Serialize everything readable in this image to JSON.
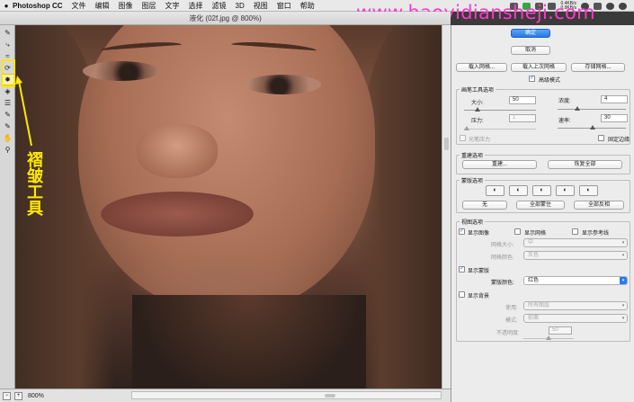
{
  "menubar": {
    "apple": "",
    "app": "Photoshop CC",
    "menus": [
      "文件",
      "编辑",
      "图像",
      "图层",
      "文字",
      "选择",
      "滤镜",
      "3D",
      "视图",
      "窗口",
      "帮助"
    ],
    "net_up": "0.4KB/s",
    "net_down": "0.9KB/s"
  },
  "watermark": "www.haoyidiansheji.com",
  "window": {
    "title": "液化 (02f.jpg @ 800%)"
  },
  "annotation": {
    "label": "褶皱工具"
  },
  "status": {
    "zoom": "800%"
  },
  "panel": {
    "ok": "确定",
    "cancel": "取消",
    "load_mesh": "载入网格...",
    "load_last": "载入上次网格",
    "save_mesh": "存储网格...",
    "advanced": "高级模式",
    "brush_group": "画笔工具选项",
    "size_label": "大小:",
    "size_value": "50",
    "density_label": "浓度:",
    "density_value": "4",
    "pressure_label": "压力:",
    "pressure_value": "1",
    "rate_label": "速率:",
    "rate_value": "30",
    "stylus": "光笔压力",
    "pin_edges": "固定边缘",
    "rebuild_group": "重建选项",
    "rebuild_btn": "重建...",
    "restore_btn": "恢复全部",
    "mask_group": "蒙版选项",
    "mask_none": "无",
    "mask_all": "全部蒙住",
    "mask_invert": "全部反相",
    "view_group": "视图选项",
    "show_image": "显示图像",
    "show_mesh": "显示网格",
    "show_guides": "显示参考线",
    "mesh_size_label": "网格大小:",
    "mesh_size_value": "中",
    "mesh_color_label": "网格颜色:",
    "mesh_color_value": "灰色",
    "show_mask": "显示蒙版",
    "mask_color_label": "蒙版颜色:",
    "mask_color_value": "红色",
    "show_backdrop": "显示背景",
    "use_label": "使用:",
    "use_value": "所有图层",
    "mode_label": "模式:",
    "mode_value": "前面",
    "opacity_label": "不透明度:",
    "opacity_value": "50"
  },
  "colors": {
    "accent": "#2479e8",
    "watermark": "#ff39c8",
    "annotation": "#ffe800"
  }
}
